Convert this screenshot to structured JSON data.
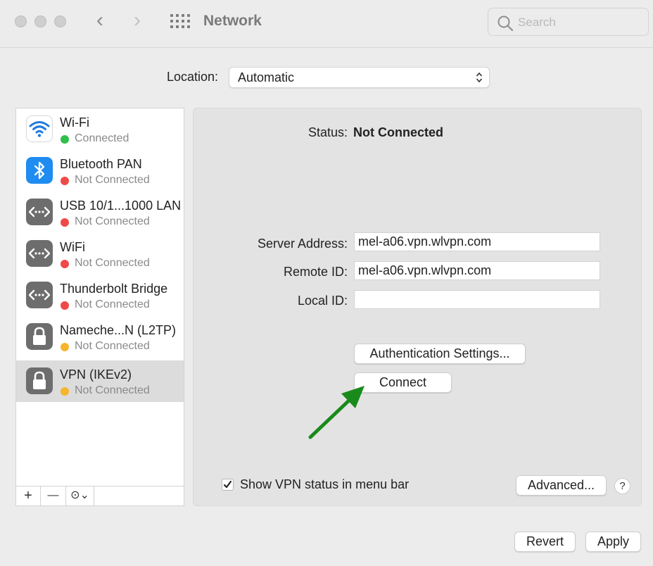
{
  "window": {
    "title": "Network",
    "back_glyph": "‹",
    "forward_glyph": "›",
    "search_placeholder": "Search"
  },
  "location": {
    "label": "Location:",
    "value": "Automatic"
  },
  "sidebar": {
    "services": [
      {
        "name": "Wi-Fi",
        "status": "Connected",
        "status_color": "#2fbf4a",
        "icon": "wifi-icon"
      },
      {
        "name": "Bluetooth PAN",
        "status": "Not Connected",
        "status_color": "#f04a48",
        "icon": "bluetooth-icon"
      },
      {
        "name": "USB 10/1...1000 LAN",
        "status": "Not Connected",
        "status_color": "#f04a48",
        "icon": "ethernet-icon"
      },
      {
        "name": "WiFi",
        "status": "Not Connected",
        "status_color": "#f04a48",
        "icon": "ethernet-icon"
      },
      {
        "name": "Thunderbolt Bridge",
        "status": "Not Connected",
        "status_color": "#f04a48",
        "icon": "ethernet-icon"
      },
      {
        "name": "Nameche...N (L2TP)",
        "status": "Not Connected",
        "status_color": "#f7b52c",
        "icon": "lock-icon"
      },
      {
        "name": "VPN (IKEv2)",
        "status": "Not Connected",
        "status_color": "#f7b52c",
        "icon": "lock-icon",
        "selected": true
      }
    ],
    "toolbar": {
      "add": "+",
      "remove": "—",
      "actions": "⊙⌄"
    }
  },
  "detail": {
    "status_label": "Status:",
    "status_value": "Not Connected",
    "server_address_label": "Server Address:",
    "server_address_value": "mel-a06.vpn.wlvpn.com",
    "remote_id_label": "Remote ID:",
    "remote_id_value": "mel-a06.vpn.wlvpn.com",
    "local_id_label": "Local ID:",
    "local_id_value": "",
    "auth_button": "Authentication Settings...",
    "connect_button": "Connect",
    "show_vpn_label": "Show VPN status in menu bar",
    "show_vpn_checked": true,
    "advanced_button": "Advanced...",
    "help_button": "?"
  },
  "footer": {
    "revert_button": "Revert",
    "apply_button": "Apply"
  },
  "colors": {
    "annotation_arrow": "#1a8a1a",
    "selected_row": "#dcdcdc"
  }
}
